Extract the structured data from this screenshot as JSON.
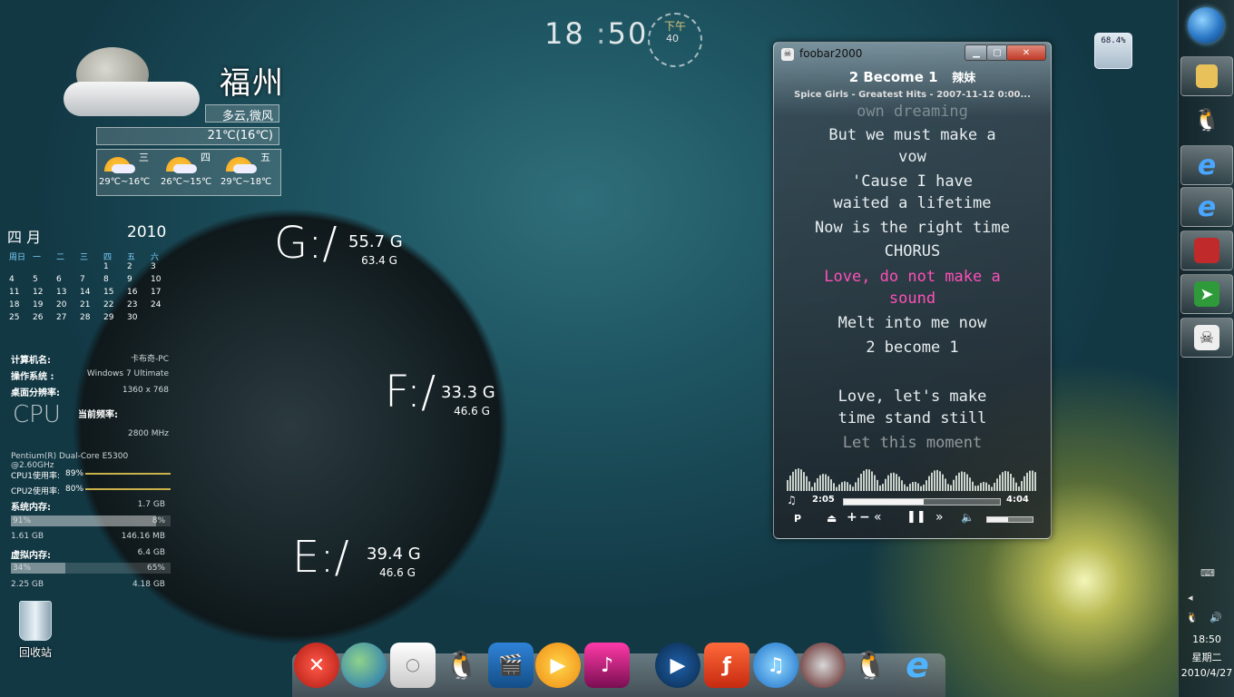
{
  "clock": {
    "hour": "18",
    "minute": "50",
    "ampm": "下午",
    "seconds": "40"
  },
  "weather": {
    "city": "福州",
    "condition": "多云,微风",
    "temp": "21℃(16℃)",
    "forecast": [
      {
        "day": "三",
        "range": "29℃~16℃"
      },
      {
        "day": "四",
        "range": "26℃~15℃"
      },
      {
        "day": "五",
        "range": "29℃~18℃"
      }
    ]
  },
  "calendar": {
    "month": "四 月",
    "year": "2010",
    "weekdays": [
      "周日",
      "一",
      "二",
      "三",
      "四",
      "五",
      "六"
    ],
    "weeks": [
      [
        "",
        "",
        "",
        "",
        "1",
        "2",
        "3"
      ],
      [
        "4",
        "5",
        "6",
        "7",
        "8",
        "9",
        "10"
      ],
      [
        "11",
        "12",
        "13",
        "14",
        "15",
        "16",
        "17"
      ],
      [
        "18",
        "19",
        "20",
        "21",
        "22",
        "23",
        "24"
      ],
      [
        "25",
        "26",
        "27",
        "28",
        "29",
        "30",
        ""
      ]
    ]
  },
  "sysinfo": {
    "computer_label": "计算机名:",
    "computer_value": "卡布奇-PC",
    "os_label": "操作系统 :",
    "os_value": "Windows 7 Ultimate",
    "res_label": "桌面分辨率:",
    "res_value": "1360 x 768",
    "cpu_logo": "CPU",
    "freq_label": "当前频率:",
    "freq_value": "2800 MHz",
    "cpu_model": "Pentium(R) Dual-Core E5300 @2.60GHz",
    "cpu1_label": "CPU1使用率:",
    "cpu1_value": "89%",
    "cpu2_label": "CPU2使用率:",
    "cpu2_value": "80%",
    "mem_label": "系统内存:",
    "mem_total": "1.7 GB",
    "mem_used_pct": "91%",
    "mem_free_pct": "8%",
    "mem_used": "1.61 GB",
    "mem_free": "146.16 MB",
    "vmem_label": "虚拟内存:",
    "vmem_total": "6.4 GB",
    "vmem_used_pct": "34%",
    "vmem_free_pct": "65%",
    "vmem_used": "2.25 GB",
    "vmem_free": "4.18 GB",
    "mem_fill": 0.91,
    "vmem_fill": 0.34
  },
  "drives": [
    {
      "letter": "G:/",
      "free": "55.7 G",
      "total": "63.4 G"
    },
    {
      "letter": "F:/",
      "free": "33.3 G",
      "total": "46.6 G"
    },
    {
      "letter": "E:/",
      "free": "39.4 G",
      "total": "46.6 G"
    }
  ],
  "recycle_bin": {
    "label": "回收站"
  },
  "battery_gadget": {
    "value": "68.4%"
  },
  "foobar": {
    "window_title": "foobar2000",
    "track": "2 Become 1",
    "artist_cn": "辣妹",
    "subtitle": "Spice Girls - Greatest Hits - 2007-11-12 0:00...",
    "lyrics": [
      {
        "text": "own dreaming",
        "state": "faded"
      },
      {
        "text": "But we must make a",
        "state": "normal"
      },
      {
        "text": "vow",
        "state": "normal"
      },
      {
        "text": "'Cause I have",
        "state": "normal"
      },
      {
        "text": "waited a lifetime",
        "state": "normal"
      },
      {
        "text": "Now is the right time",
        "state": "normal"
      },
      {
        "text": "CHORUS",
        "state": "normal"
      },
      {
        "text": "Love, do not make a",
        "state": "current"
      },
      {
        "text": "sound",
        "state": "current"
      },
      {
        "text": "Melt into me now",
        "state": "normal"
      },
      {
        "text": "2 become 1",
        "state": "normal"
      },
      {
        "text": "",
        "state": "normal"
      },
      {
        "text": "Love, let's make",
        "state": "normal"
      },
      {
        "text": "time stand still",
        "state": "normal"
      },
      {
        "text": "Let this moment",
        "state": "faded"
      }
    ],
    "elapsed": "2:05",
    "duration": "4:04",
    "progress": 0.51,
    "volume": 0.45,
    "colors": {
      "current_lyric": "#ff4fb8"
    }
  },
  "taskbar": {
    "time": "18:50",
    "weekday": "星期二",
    "date": "2010/4/27"
  },
  "dock_icons": [
    "close-icon",
    "network-icon",
    "mac-icon",
    "qq-penguin-icon",
    "movie-icon",
    "media-player-icon",
    "music-app-icon",
    "play-icon",
    "flash-icon",
    "itunes-icon",
    "media-box-icon",
    "qq-icon",
    "ie-icon"
  ]
}
